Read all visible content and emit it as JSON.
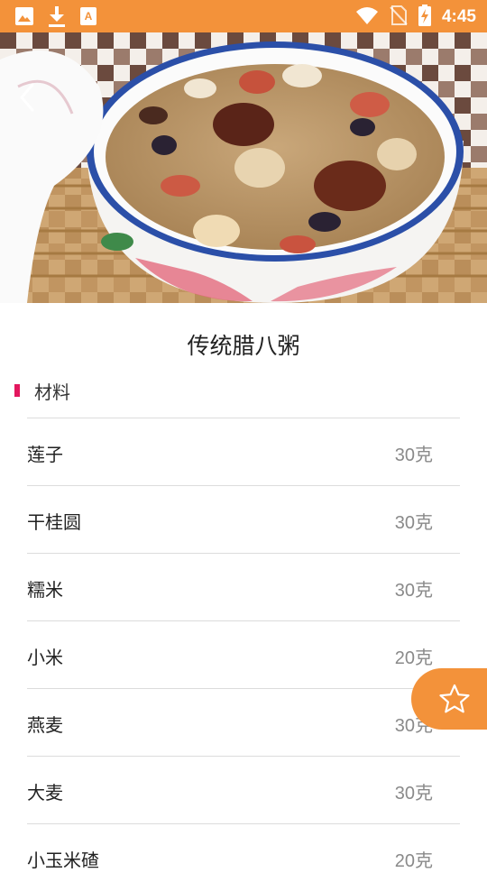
{
  "status_bar": {
    "time": "4:45",
    "left_icons": [
      "image-icon",
      "download-icon",
      "font-icon"
    ],
    "right_icons": [
      "wifi-icon",
      "no-sim-icon",
      "battery-charging-icon"
    ]
  },
  "hero": {
    "image": "laba-porridge-photo"
  },
  "recipe": {
    "title": "传统腊八粥"
  },
  "ingredients_section": {
    "label": "材料",
    "accent_color": "#e3175e",
    "items": [
      {
        "name": "莲子",
        "amount": "30克"
      },
      {
        "name": "干桂圆",
        "amount": "30克"
      },
      {
        "name": "糯米",
        "amount": "30克"
      },
      {
        "name": "小米",
        "amount": "20克"
      },
      {
        "name": "燕麦",
        "amount": "30克"
      },
      {
        "name": "大麦",
        "amount": "30克"
      },
      {
        "name": "小玉米碴",
        "amount": "20克"
      }
    ]
  },
  "theme": {
    "primary": "#f3923a"
  }
}
